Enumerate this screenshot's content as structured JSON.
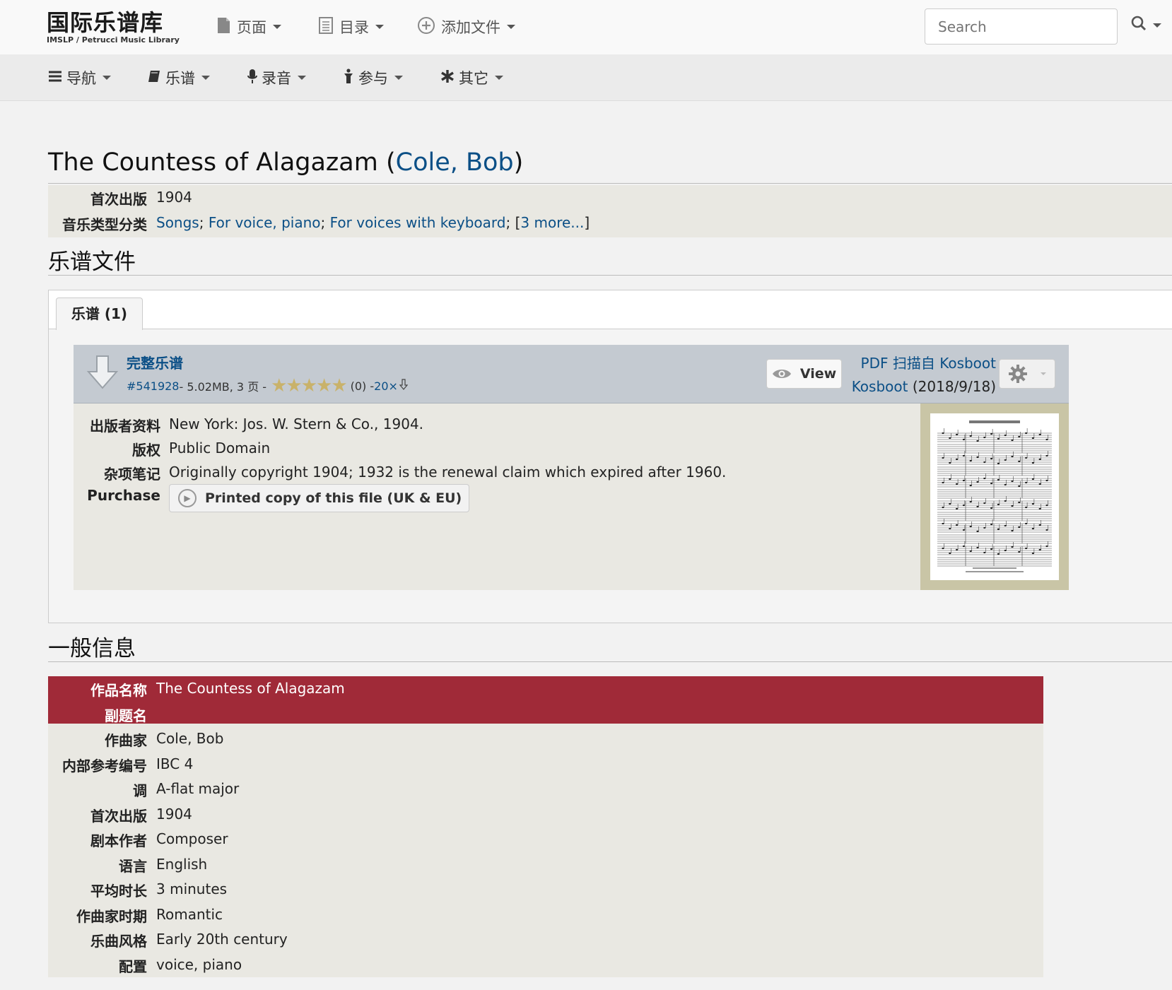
{
  "header": {
    "logo_title": "国际乐谱库",
    "logo_subtitle": "IMSLP / Petrucci Music Library",
    "menus": [
      {
        "label": "页面",
        "icon": "page-icon"
      },
      {
        "label": "目录",
        "icon": "list-icon"
      },
      {
        "label": "添加文件",
        "icon": "plus-circle-icon"
      }
    ],
    "search_placeholder": "Search"
  },
  "navbar": {
    "items": [
      {
        "label": "导航",
        "icon": "bars-icon"
      },
      {
        "label": "乐谱",
        "icon": "book-icon"
      },
      {
        "label": "录音",
        "icon": "microphone-icon"
      },
      {
        "label": "参与",
        "icon": "person-icon"
      },
      {
        "label": "其它",
        "icon": "asterisk-icon"
      }
    ]
  },
  "page": {
    "title_work": "The Countess of Alagazam",
    "title_paren_open": " (",
    "title_composer": "Cole, Bob",
    "title_paren_close": ")"
  },
  "summary": {
    "first_pub_label": "首次出版",
    "first_pub_value": "1904",
    "genre_label": "音乐类型分类",
    "genre_links": [
      "Songs",
      "For voice, piano",
      "For voices with keyboard"
    ],
    "genre_more": "3 more...",
    "sep": ";",
    "bracket_open": "[",
    "bracket_close": "]"
  },
  "files_section": {
    "heading": "乐谱文件",
    "tab_label": "乐谱 (1)",
    "file": {
      "title": "完整乐谱",
      "id": "#541928",
      "meta": " - 5.02MB, 3 页 - ",
      "rating_count": "(0) - ",
      "downloads": "20×",
      "view_label": "View",
      "pdf_line1": "PDF 扫描自 Kosboot",
      "uploader": "Kosboot",
      "upload_date": " (2018/9/18)",
      "rows": [
        {
          "label": "出版者资料",
          "value": "New York: Jos. W. Stern & Co., 1904."
        },
        {
          "label": "版权",
          "value": "Public Domain"
        },
        {
          "label": "杂项笔记",
          "value": "Originally copyright 1904; 1932 is the renewal claim which expired after 1960."
        }
      ],
      "purchase_label": "Purchase",
      "purchase_button": "Printed copy of this file (UK & EU)"
    }
  },
  "general_section": {
    "heading": "一般信息",
    "rows": [
      {
        "label": "作品名称",
        "value": "The Countess of Alagazam"
      },
      {
        "label": "副题名",
        "value": ""
      },
      {
        "label": "作曲家",
        "value": "Cole, Bob"
      },
      {
        "label": "内部参考编号",
        "value": "IBC 4"
      },
      {
        "label": "调",
        "value": "A-flat major"
      },
      {
        "label": "首次出版",
        "value": "1904"
      },
      {
        "label": "剧本作者",
        "value": "Composer"
      },
      {
        "label": "语言",
        "value": "English"
      },
      {
        "label": "平均时长",
        "value": "3 minutes"
      },
      {
        "label": "作曲家时期",
        "value": "Romantic"
      },
      {
        "label": "乐曲风格",
        "value": "Early 20th century"
      },
      {
        "label": "配置",
        "value": "voice, piano"
      }
    ]
  },
  "colors": {
    "link": "#0b4f86",
    "red_band": "#a02a38",
    "file_header": "#c4cad1"
  }
}
